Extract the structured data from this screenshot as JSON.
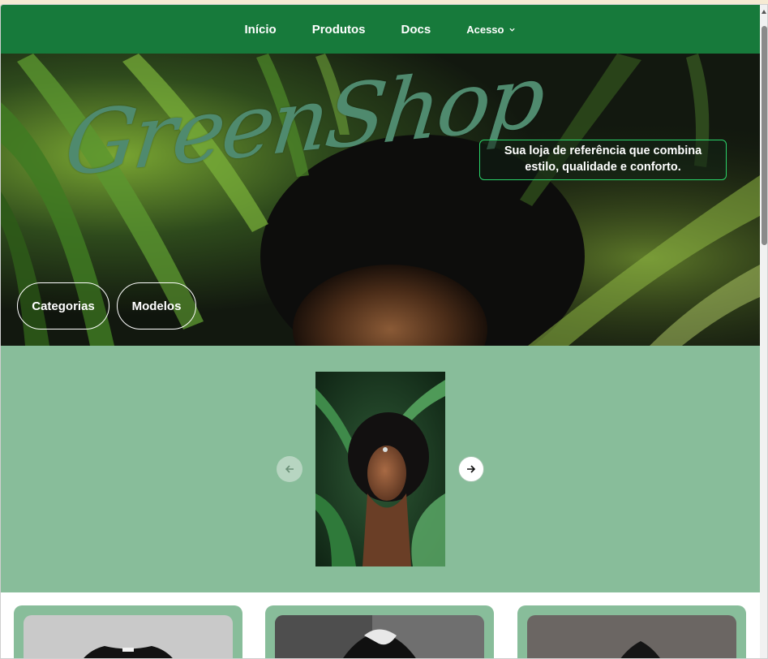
{
  "navbar": {
    "items": [
      {
        "label": "Início"
      },
      {
        "label": "Produtos"
      },
      {
        "label": "Docs"
      }
    ],
    "dropdown": {
      "label": "Acesso",
      "icon": "chevron-down-icon"
    }
  },
  "hero": {
    "brand": "GreenShop",
    "tagline": "Sua loja de referência que combina estilo, qualidade e conforto.",
    "buttons": {
      "categories": "Categorias",
      "models": "Modelos"
    }
  },
  "carousel": {
    "prev_icon": "arrow-left-icon",
    "next_icon": "arrow-right-icon"
  },
  "colors": {
    "navbar": "#177a3b",
    "carousel_bg": "#88bd9a",
    "tagline_border": "#2bd46a",
    "brand": "#4f8a6e"
  }
}
